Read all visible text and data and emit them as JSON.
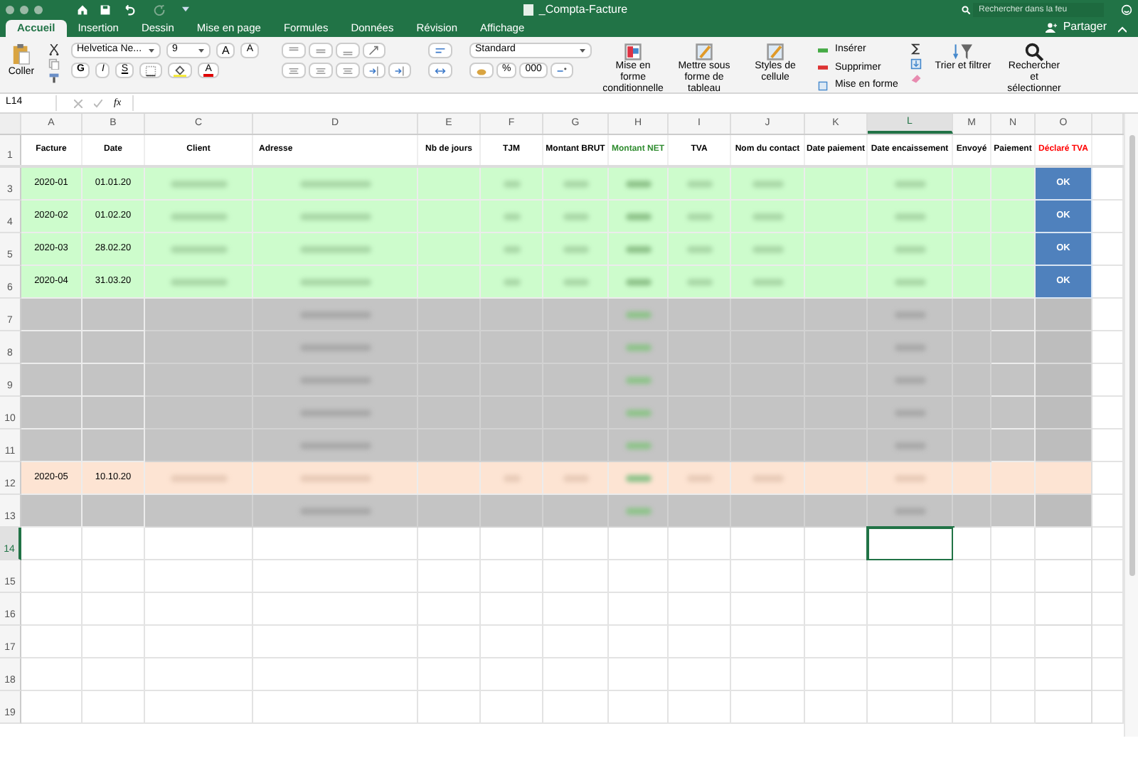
{
  "window": {
    "title": "_Compta-Facture",
    "search_placeholder": "Rechercher dans la feu"
  },
  "ribbon_tabs": [
    {
      "label": "Accueil",
      "selected": true
    },
    {
      "label": "Insertion",
      "selected": false
    },
    {
      "label": "Dessin",
      "selected": false
    },
    {
      "label": "Mise en page",
      "selected": false
    },
    {
      "label": "Formules",
      "selected": false
    },
    {
      "label": "Données",
      "selected": false
    },
    {
      "label": "Révision",
      "selected": false
    },
    {
      "label": "Affichage",
      "selected": false
    }
  ],
  "share_button": "Partager",
  "ribbon": {
    "paste": "Coller",
    "font": "Helvetica Ne...",
    "font_size": "9",
    "bold": "G",
    "italic": "I",
    "underline": "S",
    "grow_font": "A",
    "shrink_font": "A",
    "font_color": "A",
    "number_format": "Standard",
    "percent": "%",
    "thousands": "000",
    "conditional_format": "Mise en forme conditionnelle",
    "format_table": "Mettre sous forme de tableau",
    "cell_styles": "Styles de cellule",
    "insert": "Insérer",
    "delete": "Supprimer",
    "format": "Mise en forme",
    "sort_filter": "Trier et filtrer",
    "find_select": "Rechercher et sélectionner"
  },
  "formula_bar": {
    "name_box": "L14",
    "fx": "fx"
  },
  "sheet": {
    "columns": [
      {
        "letter": "A",
        "selected": false
      },
      {
        "letter": "B",
        "selected": false
      },
      {
        "letter": "C",
        "selected": false
      },
      {
        "letter": "D",
        "selected": false
      },
      {
        "letter": "E",
        "selected": false
      },
      {
        "letter": "F",
        "selected": false
      },
      {
        "letter": "G",
        "selected": false
      },
      {
        "letter": "H",
        "selected": false
      },
      {
        "letter": "I",
        "selected": false
      },
      {
        "letter": "J",
        "selected": false
      },
      {
        "letter": "K",
        "selected": false
      },
      {
        "letter": "L",
        "selected": true
      },
      {
        "letter": "M",
        "selected": false
      },
      {
        "letter": "N",
        "selected": false
      },
      {
        "letter": "O",
        "selected": false
      }
    ],
    "header_row": {
      "number": "1",
      "cells": [
        {
          "text": "Facture",
          "color": "#000000"
        },
        {
          "text": "Date",
          "color": "#000000"
        },
        {
          "text": "Client",
          "color": "#000000"
        },
        {
          "text": "Adresse",
          "color": "#000000"
        },
        {
          "text": "Nb de jours",
          "color": "#000000"
        },
        {
          "text": "TJM",
          "color": "#000000"
        },
        {
          "text": "Montant BRUT",
          "color": "#000000"
        },
        {
          "text": "Montant NET",
          "color": "#2e8b2e"
        },
        {
          "text": "TVA",
          "color": "#000000"
        },
        {
          "text": "Nom du contact",
          "color": "#000000"
        },
        {
          "text": "Date paiement",
          "color": "#000000"
        },
        {
          "text": "Date encaissement",
          "color": "#000000"
        },
        {
          "text": "Envoyé",
          "color": "#000000"
        },
        {
          "text": "Paiement",
          "color": "#000000"
        },
        {
          "text": "Déclaré TVA",
          "color": "#ff0000"
        }
      ]
    },
    "rows": [
      {
        "number": "3",
        "kind": "green",
        "selected": false,
        "facture": "2020-01",
        "date": "01.01.20",
        "declared": "OK"
      },
      {
        "number": "4",
        "kind": "green",
        "selected": false,
        "facture": "2020-02",
        "date": "01.02.20",
        "declared": "OK"
      },
      {
        "number": "5",
        "kind": "green",
        "selected": false,
        "facture": "2020-03",
        "date": "28.02.20",
        "declared": "OK"
      },
      {
        "number": "6",
        "kind": "green",
        "selected": false,
        "facture": "2020-04",
        "date": "31.03.20",
        "declared": "OK"
      },
      {
        "number": "7",
        "kind": "grey",
        "selected": false
      },
      {
        "number": "8",
        "kind": "grey",
        "selected": false
      },
      {
        "number": "9",
        "kind": "grey",
        "selected": false
      },
      {
        "number": "10",
        "kind": "grey",
        "selected": false
      },
      {
        "number": "11",
        "kind": "grey",
        "selected": false
      },
      {
        "number": "12",
        "kind": "peach",
        "selected": false,
        "facture": "2020-05",
        "date": "10.10.20"
      },
      {
        "number": "13",
        "kind": "grey",
        "selected": false
      },
      {
        "number": "14",
        "kind": "empty",
        "selected": true
      },
      {
        "number": "15",
        "kind": "empty",
        "selected": false
      },
      {
        "number": "16",
        "kind": "empty",
        "selected": false
      },
      {
        "number": "17",
        "kind": "empty",
        "selected": false
      },
      {
        "number": "18",
        "kind": "empty",
        "selected": false
      },
      {
        "number": "19",
        "kind": "empty",
        "selected": false
      }
    ]
  }
}
